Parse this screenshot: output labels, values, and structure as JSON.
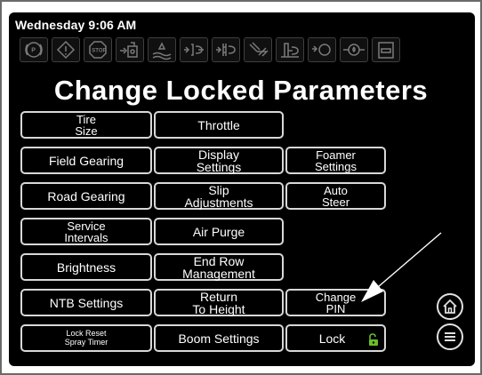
{
  "header": {
    "datetime": "Wednesday 9:06 AM"
  },
  "status_icons": [
    "park-icon",
    "warning-icon",
    "stop-icon",
    "implement-icon",
    "water-icon",
    "hitch-icon",
    "hydraulic-icon",
    "steering-icon",
    "boom-icon",
    "engine-icon",
    "oil-pressure-icon",
    "battery-icon"
  ],
  "page": {
    "title": "Change Locked Parameters"
  },
  "buttons": {
    "tire_size": "Tire\nSize",
    "throttle": "Throttle",
    "field_gearing": "Field Gearing",
    "display_settings": "Display\nSettings",
    "foamer_settings": "Foamer\nSettings",
    "road_gearing": "Road Gearing",
    "slip_adjustments": "Slip\nAdjustments",
    "auto_steer": "Auto\nSteer",
    "service_intervals": "Service\nIntervals",
    "air_purge": "Air Purge",
    "brightness": "Brightness",
    "end_row_management": "End Row\nManagement",
    "ntb_settings": "NTB Settings",
    "return_to_height": "Return\nTo Height",
    "change_pin": "Change\nPIN",
    "lock_reset_spray_timer": "Lock Reset\nSpray Timer",
    "boom_settings": "Boom Settings",
    "lock": "Lock"
  },
  "nav_icons": {
    "home": "home-icon",
    "menu": "menu-icon"
  },
  "colors": {
    "screen_bg": "#000000",
    "button_border": "#d8d8d8",
    "lock_icon": "#6abf2a",
    "status_icon": "#7a7a7a"
  }
}
